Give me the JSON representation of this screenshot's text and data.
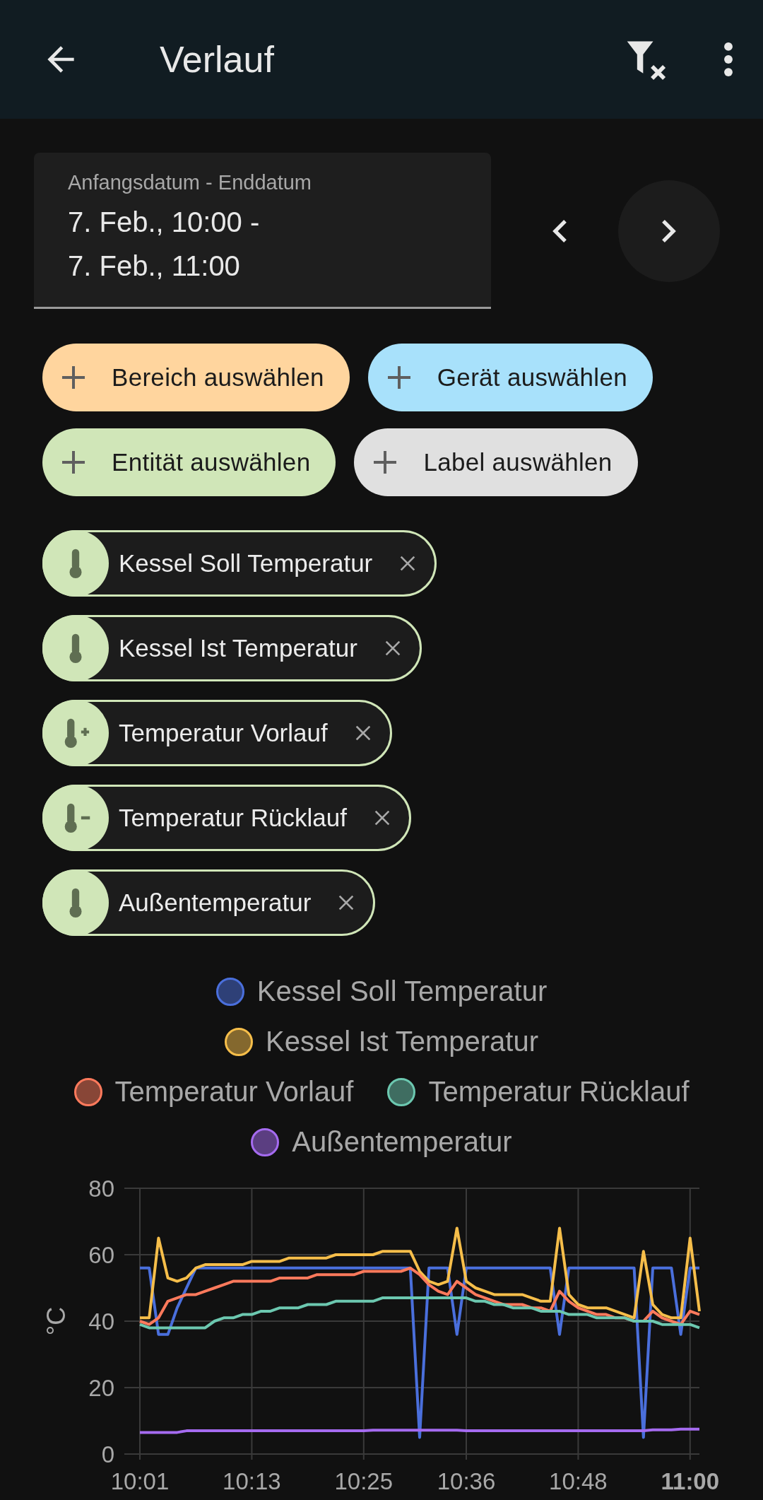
{
  "app_bar": {
    "title": "Verlauf"
  },
  "date_range": {
    "label": "Anfangsdatum - Enddatum",
    "value": "7. Feb., 10:00 -\n7. Feb., 11:00"
  },
  "filter_chips": [
    {
      "label": "Bereich auswählen",
      "color": "#ffd59e"
    },
    {
      "label": "Gerät auswählen",
      "color": "#a8e1fb"
    },
    {
      "label": "Entität auswählen",
      "color": "#d0e6b8"
    },
    {
      "label": "Label auswählen",
      "color": "#e0e0e0"
    }
  ],
  "entities": [
    {
      "label": "Kessel Soll Temperatur",
      "kind": "thermometer"
    },
    {
      "label": "Kessel Ist Temperatur",
      "kind": "thermometer"
    },
    {
      "label": "Temperatur Vorlauf",
      "kind": "thermometer-plus"
    },
    {
      "label": "Temperatur Rücklauf",
      "kind": "thermometer-minus"
    },
    {
      "label": "Außentemperatur",
      "kind": "thermometer"
    }
  ],
  "chart": {
    "chart_data": {
      "type": "line",
      "grid": true,
      "ylabel": "°C",
      "ylim": [
        0,
        80
      ],
      "yticks": [
        0,
        20,
        40,
        60,
        80
      ],
      "categories": [
        "10:01",
        null,
        null,
        null,
        null,
        null,
        null,
        null,
        null,
        null,
        null,
        null,
        "10:13",
        null,
        null,
        null,
        null,
        null,
        null,
        null,
        null,
        null,
        null,
        null,
        "10:25",
        null,
        null,
        null,
        null,
        null,
        null,
        null,
        null,
        null,
        null,
        "10:36",
        null,
        null,
        null,
        null,
        null,
        null,
        null,
        null,
        null,
        null,
        null,
        "10:48",
        null,
        null,
        null,
        null,
        null,
        null,
        null,
        null,
        null,
        null,
        null,
        "11:00",
        null
      ],
      "series": [
        {
          "name": "Kessel Soll Temperatur",
          "color": "#4a6fdc",
          "values": [
            56,
            56,
            36,
            36,
            44,
            50,
            56,
            56,
            56,
            56,
            56,
            56,
            56,
            56,
            56,
            56,
            56,
            56,
            56,
            56,
            56,
            56,
            56,
            56,
            56,
            56,
            56,
            56,
            56,
            56,
            5,
            56,
            56,
            56,
            36,
            56,
            56,
            56,
            56,
            56,
            56,
            56,
            56,
            56,
            56,
            36,
            56,
            56,
            56,
            56,
            56,
            56,
            56,
            56,
            5,
            56,
            56,
            56,
            36,
            56,
            56
          ]
        },
        {
          "name": "Kessel Ist Temperatur",
          "color": "#f6be4a",
          "values": [
            41,
            41,
            65,
            53,
            52,
            53,
            56,
            57,
            57,
            57,
            57,
            57,
            58,
            58,
            58,
            58,
            59,
            59,
            59,
            59,
            59,
            60,
            60,
            60,
            60,
            60,
            61,
            61,
            61,
            61,
            55,
            52,
            51,
            52,
            68,
            52,
            50,
            49,
            48,
            48,
            48,
            48,
            47,
            46,
            46,
            68,
            48,
            45,
            44,
            44,
            44,
            43,
            42,
            41,
            61,
            45,
            42,
            41,
            41,
            65,
            43
          ]
        },
        {
          "name": "Temperatur Vorlauf",
          "color": "#ff7a5c",
          "values": [
            40,
            39,
            41,
            46,
            47,
            48,
            48,
            49,
            50,
            51,
            52,
            52,
            52,
            52,
            52,
            53,
            53,
            53,
            53,
            54,
            54,
            54,
            54,
            54,
            55,
            55,
            55,
            55,
            55,
            56,
            54,
            51,
            49,
            48,
            52,
            50,
            48,
            47,
            46,
            45,
            45,
            45,
            44,
            44,
            43,
            49,
            46,
            44,
            43,
            42,
            42,
            41,
            41,
            40,
            40,
            43,
            41,
            40,
            39,
            43,
            42
          ]
        },
        {
          "name": "Temperatur Rücklauf",
          "color": "#6cc8b0",
          "values": [
            39,
            38,
            38,
            38,
            38,
            38,
            38,
            38,
            40,
            41,
            41,
            42,
            42,
            43,
            43,
            44,
            44,
            44,
            45,
            45,
            45,
            46,
            46,
            46,
            46,
            46,
            47,
            47,
            47,
            47,
            47,
            47,
            47,
            47,
            47,
            47,
            46,
            46,
            45,
            45,
            44,
            44,
            44,
            43,
            43,
            43,
            42,
            42,
            42,
            41,
            41,
            41,
            41,
            40,
            40,
            40,
            39,
            39,
            39,
            39,
            38
          ]
        },
        {
          "name": "Außentemperatur",
          "color": "#a56bf0",
          "values": [
            6.5,
            6.5,
            6.5,
            6.5,
            6.5,
            7,
            7,
            7,
            7,
            7,
            7,
            7,
            7,
            7,
            7,
            7,
            7,
            7,
            7,
            7,
            7,
            7,
            7,
            7,
            7,
            7.2,
            7.2,
            7.2,
            7.2,
            7.2,
            7.2,
            7.2,
            7.2,
            7.2,
            7.2,
            7,
            7,
            7,
            7,
            7,
            7,
            7,
            7,
            7,
            7,
            7,
            7,
            7,
            7,
            7,
            7,
            7,
            7,
            7,
            7,
            7.3,
            7.3,
            7.3,
            7.5,
            7.5,
            7.5
          ]
        }
      ]
    }
  }
}
